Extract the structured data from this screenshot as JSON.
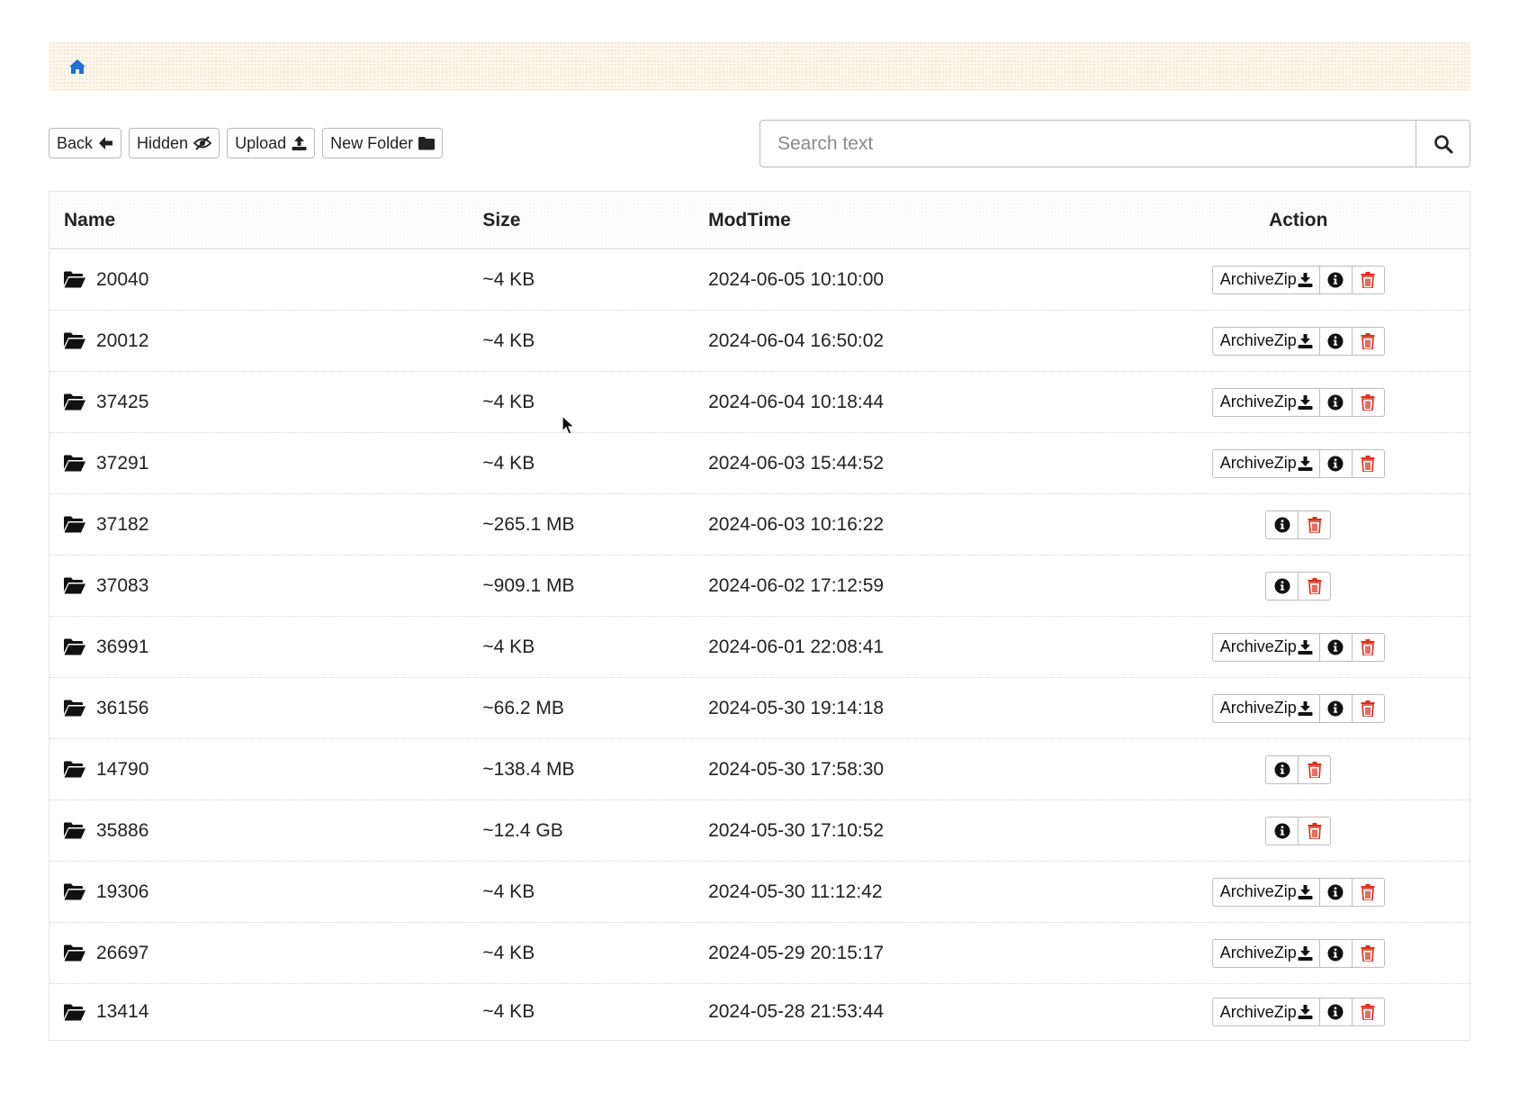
{
  "breadcrumb": {
    "home_icon": "home-icon",
    "accent": "#1f6fd6"
  },
  "toolbar": {
    "back_label": "Back",
    "hidden_label": "Hidden",
    "upload_label": "Upload",
    "new_folder_label": "New Folder"
  },
  "search": {
    "placeholder": "Search text",
    "value": ""
  },
  "table": {
    "headers": {
      "name": "Name",
      "size": "Size",
      "modtime": "ModTime",
      "action": "Action"
    },
    "archive_label": "ArchiveZip",
    "delete_color": "#d9301e",
    "rows": [
      {
        "name": "20040",
        "size": "~4 KB",
        "modtime": "2024-06-05 10:10:00",
        "archive": true
      },
      {
        "name": "20012",
        "size": "~4 KB",
        "modtime": "2024-06-04 16:50:02",
        "archive": true
      },
      {
        "name": "37425",
        "size": "~4 KB",
        "modtime": "2024-06-04 10:18:44",
        "archive": true
      },
      {
        "name": "37291",
        "size": "~4 KB",
        "modtime": "2024-06-03 15:44:52",
        "archive": true
      },
      {
        "name": "37182",
        "size": "~265.1 MB",
        "modtime": "2024-06-03 10:16:22",
        "archive": false
      },
      {
        "name": "37083",
        "size": "~909.1 MB",
        "modtime": "2024-06-02 17:12:59",
        "archive": false
      },
      {
        "name": "36991",
        "size": "~4 KB",
        "modtime": "2024-06-01 22:08:41",
        "archive": true
      },
      {
        "name": "36156",
        "size": "~66.2 MB",
        "modtime": "2024-05-30 19:14:18",
        "archive": true
      },
      {
        "name": "14790",
        "size": "~138.4 MB",
        "modtime": "2024-05-30 17:58:30",
        "archive": false
      },
      {
        "name": "35886",
        "size": "~12.4 GB",
        "modtime": "2024-05-30 17:10:52",
        "archive": false
      },
      {
        "name": "19306",
        "size": "~4 KB",
        "modtime": "2024-05-30 11:12:42",
        "archive": true
      },
      {
        "name": "26697",
        "size": "~4 KB",
        "modtime": "2024-05-29 20:15:17",
        "archive": true
      },
      {
        "name": "13414",
        "size": "~4 KB",
        "modtime": "2024-05-28 21:53:44",
        "archive": true
      }
    ]
  }
}
